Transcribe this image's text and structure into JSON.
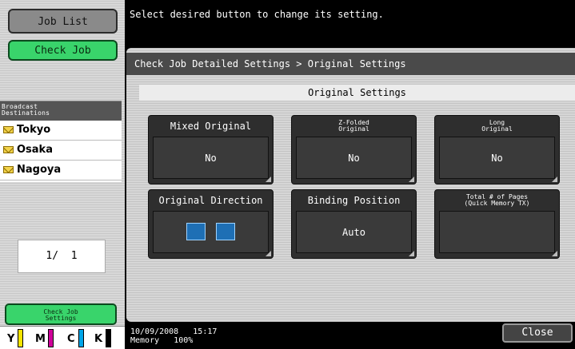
{
  "left": {
    "job_list_label": "Job List",
    "check_job_label": "Check Job",
    "dest_header_line1": "Broadcast",
    "dest_header_line2": "Destinations",
    "destinations": [
      "Tokyo",
      "Osaka",
      "Nagoya"
    ],
    "page_indicator": "1/  1",
    "check_job_settings_line1": "Check Job",
    "check_job_settings_line2": "Settings",
    "toner": [
      "Y",
      "M",
      "C",
      "K"
    ],
    "toner_colors": [
      "#f5e400",
      "#d0009a",
      "#00a5e8",
      "#000000"
    ]
  },
  "header": {
    "message": "Select desired button to change its setting."
  },
  "main": {
    "breadcrumb": "Check Job Detailed Settings > Original Settings",
    "section_title": "Original Settings",
    "settings": [
      {
        "title": "Mixed Original",
        "value": "No"
      },
      {
        "title_line1": "Z-Folded",
        "title_line2": "Original",
        "value": "No"
      },
      {
        "title_line1": "Long",
        "title_line2": "Original",
        "value": "No"
      },
      {
        "title": "Original Direction",
        "icons": [
          "original-direction-icon-1",
          "original-direction-icon-2"
        ]
      },
      {
        "title": "Binding Position",
        "value": "Auto"
      },
      {
        "title_line1": "Total # of Pages",
        "title_line2": "(Quick Memory TX)",
        "value": ""
      }
    ]
  },
  "footer": {
    "date": "10/09/2008",
    "time": "15:17",
    "memory_label": "Memory",
    "memory_value": "100%",
    "close_label": "Close"
  }
}
